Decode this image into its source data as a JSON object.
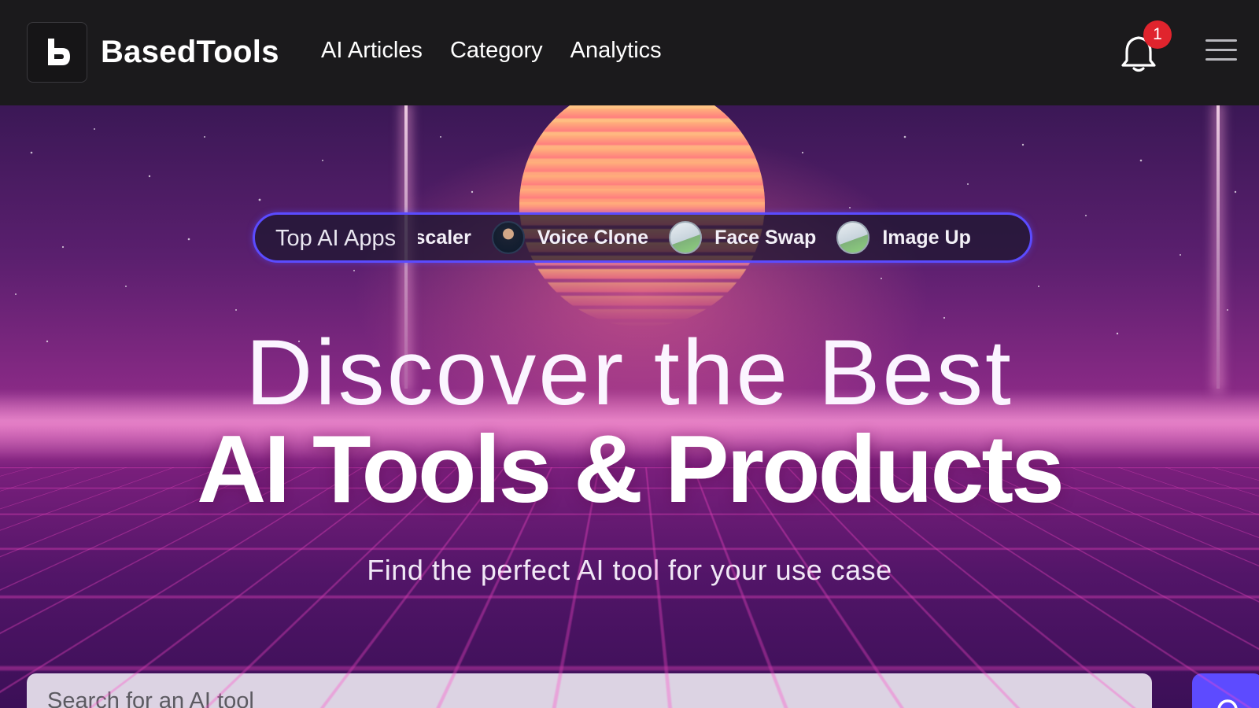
{
  "nav": {
    "brand": "BasedTools",
    "links": [
      "AI Articles",
      "Category",
      "Analytics"
    ],
    "notification_count": "1",
    "icons": {
      "logo": "basedtools-logo-icon",
      "bell": "bell-icon",
      "menu": "hamburger-menu-icon"
    }
  },
  "ticker": {
    "label": "Top AI Apps",
    "items": [
      {
        "label": "Image Upscaler",
        "icon": "app-thumbnail-icon"
      },
      {
        "label": "Voice Clone",
        "icon": "app-avatar-icon"
      },
      {
        "label": "Face Swap",
        "icon": "app-thumbnail-icon"
      },
      {
        "label": "Image Up",
        "icon": "app-thumbnail-icon"
      }
    ]
  },
  "hero": {
    "headline_light": "Discover the Best",
    "headline_bold": "AI Tools & Products",
    "subtitle": "Find the perfect AI tool for your use case"
  },
  "search": {
    "placeholder": "Search for an AI tool",
    "button_icon": "search-icon"
  },
  "colors": {
    "nav_bg": "#1b1a1c",
    "accent": "#5d4bff",
    "badge": "#e0242d"
  }
}
